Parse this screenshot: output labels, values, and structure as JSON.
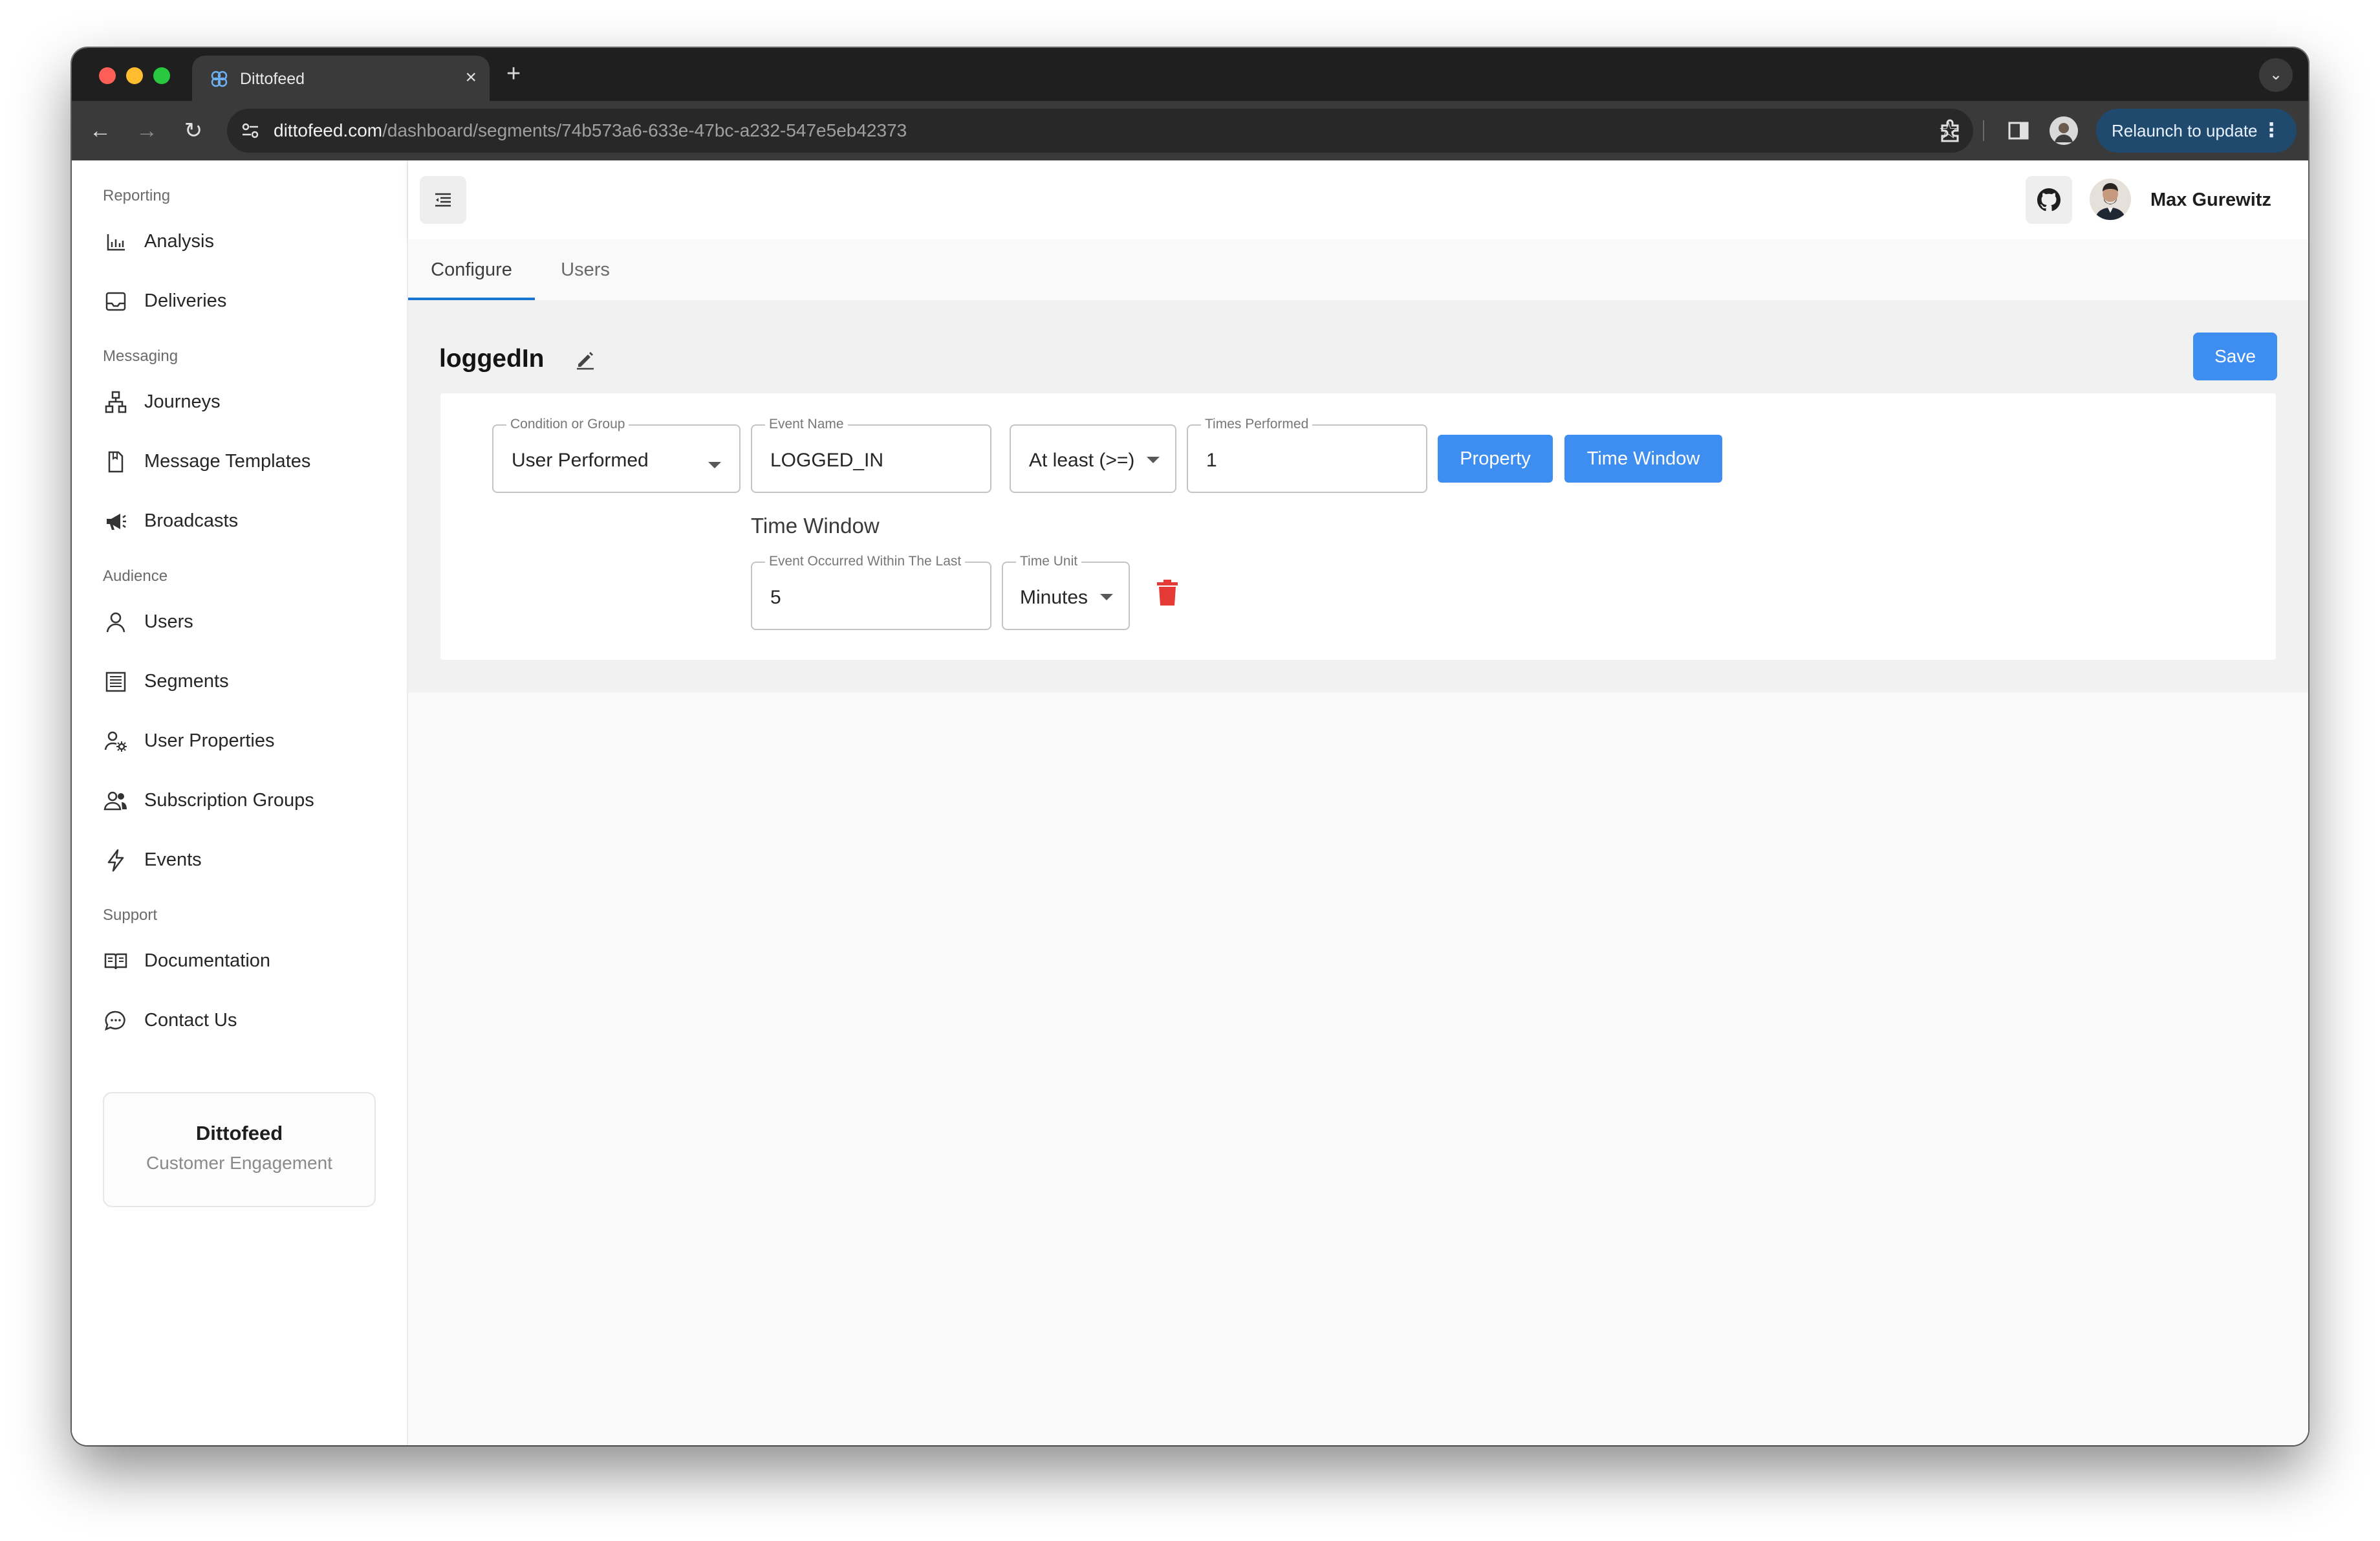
{
  "browser": {
    "tab_title": "Dittofeed",
    "tab_close": "×",
    "new_tab": "+",
    "tab_menu": "⌄",
    "url_host": "dittofeed.com",
    "url_path": "/dashboard/segments/74b573a6-633e-47bc-a232-547e5eb42373",
    "relaunch_label": "Relaunch to update",
    "nav_back": "←",
    "nav_forward": "→",
    "nav_reload": "↻",
    "star": "☆",
    "menu_dots": "⋮"
  },
  "sidebar": {
    "sections": [
      {
        "label": "Reporting",
        "items": [
          {
            "label": "Analysis",
            "icon": "bar-chart-icon"
          },
          {
            "label": "Deliveries",
            "icon": "inbox-icon"
          }
        ]
      },
      {
        "label": "Messaging",
        "items": [
          {
            "label": "Journeys",
            "icon": "sitemap-icon"
          },
          {
            "label": "Message Templates",
            "icon": "file-icon"
          },
          {
            "label": "Broadcasts",
            "icon": "megaphone-icon"
          }
        ]
      },
      {
        "label": "Audience",
        "items": [
          {
            "label": "Users",
            "icon": "user-icon"
          },
          {
            "label": "Segments",
            "icon": "table-icon"
          },
          {
            "label": "User Properties",
            "icon": "user-settings-icon"
          },
          {
            "label": "Subscription Groups",
            "icon": "users-group-icon"
          },
          {
            "label": "Events",
            "icon": "lightning-icon"
          }
        ]
      },
      {
        "label": "Support",
        "items": [
          {
            "label": "Documentation",
            "icon": "book-icon"
          },
          {
            "label": "Contact Us",
            "icon": "chat-icon"
          }
        ]
      }
    ],
    "brand": {
      "name": "Dittofeed",
      "subtitle": "Customer Engagement"
    }
  },
  "header": {
    "user_name": "Max Gurewitz"
  },
  "page_tabs": [
    "Configure",
    "Users"
  ],
  "segment": {
    "name": "loggedIn",
    "save_label": "Save",
    "condition": {
      "condition_label": "Condition or Group",
      "condition_value": "User Performed",
      "event_label": "Event Name",
      "event_value": "LOGGED_IN",
      "operator_value": "At least (>=)",
      "times_label": "Times Performed",
      "times_value": "1",
      "property_button": "Property",
      "time_window_button": "Time Window"
    },
    "time_window": {
      "heading": "Time Window",
      "within_label": "Event Occurred Within The Last",
      "within_value": "5",
      "unit_label": "Time Unit",
      "unit_value": "Minutes"
    }
  },
  "colors": {
    "accent": "#3d8ef0",
    "tab_indicator": "#1976d2",
    "delete": "#e53935"
  }
}
